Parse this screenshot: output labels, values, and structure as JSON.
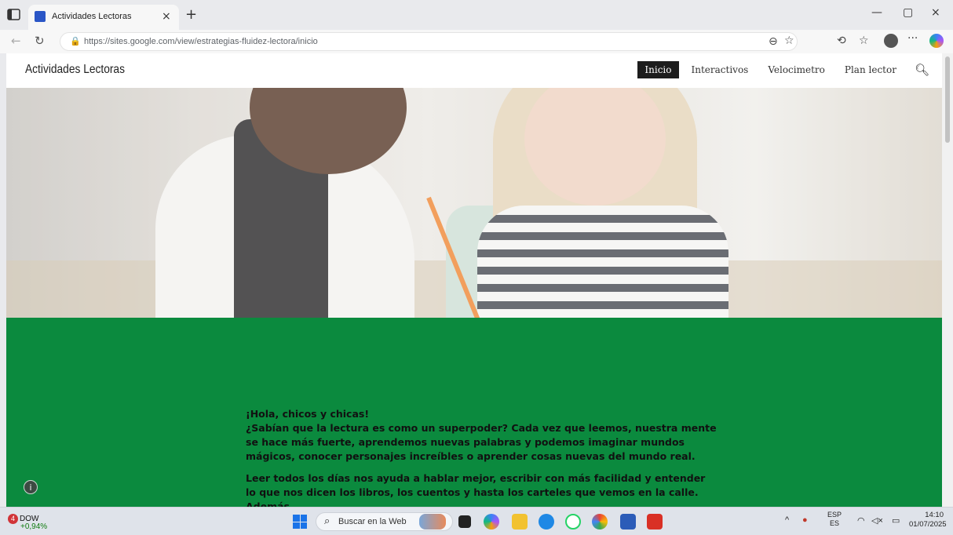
{
  "browser": {
    "tab_title": "Actividades Lectoras",
    "tab_close": "×",
    "new_tab": "+",
    "url_host": "https://sites.google.com",
    "url_path": "/view/estrategias-fluidez-lectora/inicio",
    "minimize": "—",
    "restore": "▢",
    "close": "×"
  },
  "site": {
    "title": "Actividades Lectoras",
    "nav": [
      {
        "label": "Inicio",
        "active": true
      },
      {
        "label": "Interactivos",
        "active": false
      },
      {
        "label": "Velocimetro",
        "active": false
      },
      {
        "label": "Plan lector",
        "active": false
      }
    ]
  },
  "content": {
    "greeting": "¡Hola, chicos y chicas!",
    "paragraph1": "¿Sabían que la lectura es como un superpoder? Cada vez que leemos, nuestra mente se hace más fuerte, aprendemos nuevas palabras y podemos imaginar mundos mágicos, conocer personajes increíbles o aprender cosas nuevas del mundo real.",
    "paragraph2": "Leer todos los días nos ayuda a hablar mejor, escribir con más facilidad y entender lo que nos dicen los libros, los cuentos y hasta los carteles que vemos en la calle. Además,"
  },
  "colors": {
    "green_section": "#0b8a3e",
    "nav_active_bg": "#1d1d1d"
  },
  "taskbar": {
    "stock_badge": "4",
    "stock_name": "DOW",
    "stock_change": "+0,94%",
    "search_placeholder": "Buscar en la Web",
    "lang_top": "ESP",
    "lang_bottom": "ES",
    "time": "14:10",
    "date": "01/07/2025"
  }
}
